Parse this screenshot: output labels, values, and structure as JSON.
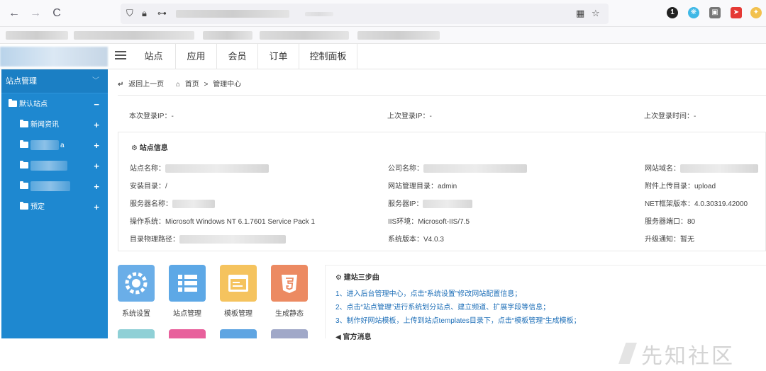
{
  "browser": {
    "back_icon": "←",
    "forward_icon": "→",
    "reload_icon": "C"
  },
  "topnav": {
    "tabs": [
      "站点",
      "应用",
      "会员",
      "订单",
      "控制面板"
    ]
  },
  "sidebar": {
    "header": "站点管理",
    "section": "默认站点",
    "items": [
      "新闻资讯",
      "a",
      "",
      "",
      "预定"
    ]
  },
  "breadcrumb": {
    "back": "返回上一页",
    "home": "首页",
    "separator": ">",
    "current": "管理中心"
  },
  "login": {
    "this_ip": "本次登录IP：-",
    "last_ip": "上次登录IP：-",
    "last_time": "上次登录时间：-"
  },
  "site_info": {
    "title": "站点信息",
    "site_name_label": "站点名称：",
    "company_label": "公司名称：",
    "domain_label": "网站域名：",
    "install_dir": "安装目录：/",
    "admin_dir": "网站管理目录：admin",
    "upload_dir": "附件上传目录：upload",
    "server_name_label": "服务器名称：",
    "server_ip_label": "服务器IP：",
    "net_version": "NET框架版本：4.0.30319.42000",
    "os": "操作系统：Microsoft Windows NT 6.1.7601 Service Pack 1",
    "iis": "IIS环境：Microsoft-IIS/7.5",
    "port": "服务器端口：80",
    "path_label": "目录物理路径：",
    "version": "系统版本：V4.0.3",
    "upgrade": "升级通知：暂无"
  },
  "shortcuts": [
    {
      "label": "系统设置",
      "color": "#6aaee8",
      "icon": "gear-icon"
    },
    {
      "label": "站点管理",
      "color": "#5da8e6",
      "icon": "list-icon"
    },
    {
      "label": "模板管理",
      "color": "#f5c35e",
      "icon": "window-icon"
    },
    {
      "label": "生成静态",
      "color": "#ec8a62",
      "icon": "html5-icon"
    }
  ],
  "steps": {
    "title": "建站三步曲",
    "items": [
      "1、进入后台管理中心，点击“系统设置”修改网站配置信息；",
      "2、点击“站点管理”进行系统划分站点、建立频道、扩展字段等信息；",
      "3、制作好网站模板，上传到站点templates目录下，点击“模板管理”生成模板；"
    ],
    "news_title": "官方消息"
  },
  "watermark": "先知社区",
  "colors": {
    "sidebar": "#1e88d0",
    "link": "#1e6fb8"
  }
}
